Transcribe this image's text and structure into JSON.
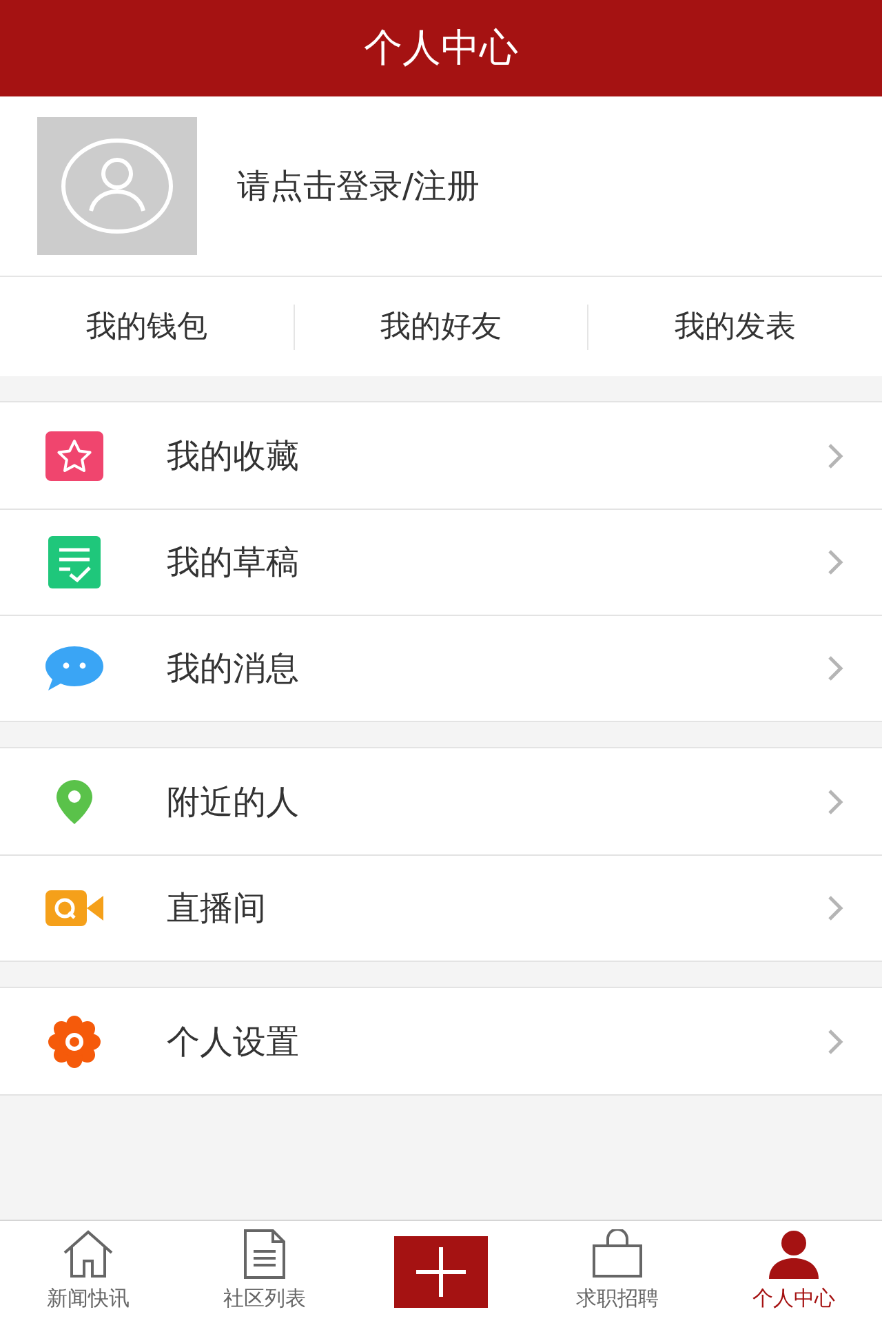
{
  "header": {
    "title": "个人中心"
  },
  "profile": {
    "login_text": "请点击登录/注册"
  },
  "stats": [
    "我的钱包",
    "我的好友",
    "我的发表"
  ],
  "menu_groups": [
    {
      "items": [
        {
          "label": "我的收藏"
        },
        {
          "label": "我的草稿"
        },
        {
          "label": "我的消息"
        }
      ]
    },
    {
      "items": [
        {
          "label": "附近的人"
        },
        {
          "label": "直播间"
        }
      ]
    },
    {
      "items": [
        {
          "label": "个人设置"
        }
      ]
    }
  ],
  "tab_bar": [
    {
      "kind": "tab",
      "label": "新闻快讯",
      "selected": false
    },
    {
      "kind": "tab",
      "label": "社区列表",
      "selected": false
    },
    {
      "kind": "add"
    },
    {
      "kind": "tab",
      "label": "求职招聘",
      "selected": false
    },
    {
      "kind": "tab",
      "label": "个人中心",
      "selected": true
    }
  ]
}
